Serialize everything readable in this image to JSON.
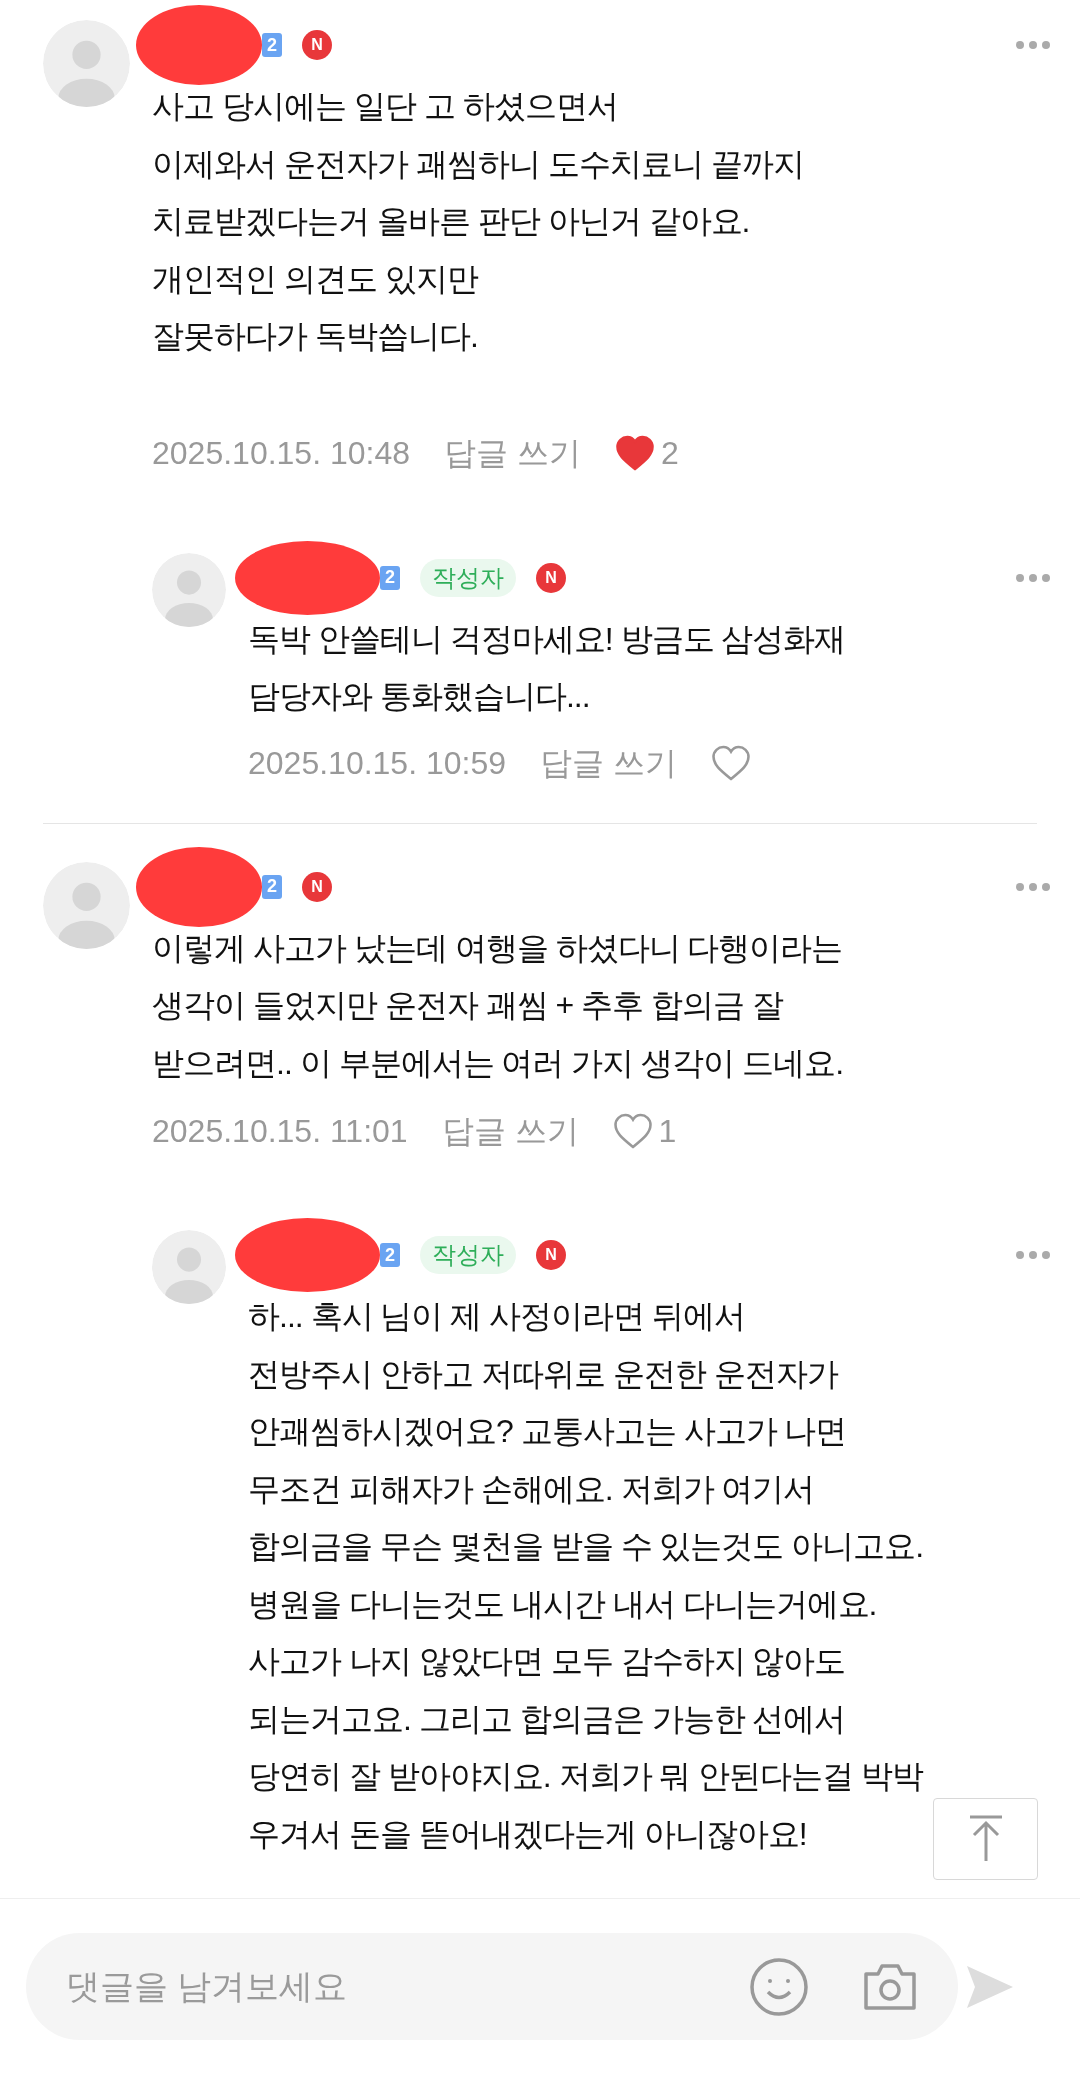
{
  "comments": [
    {
      "kind": "comment",
      "level_badge": "2",
      "new_badge": "N",
      "body": [
        "사고 당시에는 일단 고 하셨으면서",
        "이제와서 운전자가 괘씸하니 도수치료니 끝까지",
        "치료받겠다는거 올바른 판단 아닌거 같아요.",
        "개인적인 의견도 있지만",
        "잘못하다가 독박씁니다."
      ],
      "date": "2025.10.15. 10:48",
      "reply_label": "답글 쓰기",
      "liked": true,
      "like_count": "2"
    },
    {
      "kind": "reply",
      "level_badge": "2",
      "author_tag": "작성자",
      "new_badge": "N",
      "body": [
        "독박 안쓸테니 걱정마세요! 방금도 삼성화재",
        "담당자와 통화했습니다..."
      ],
      "date": "2025.10.15. 10:59",
      "reply_label": "답글 쓰기",
      "liked": false
    },
    {
      "kind": "comment",
      "level_badge": "2",
      "new_badge": "N",
      "body": [
        "이렇게 사고가 났는데 여행을 하셨다니 다행이라는",
        "생각이 들었지만 운전자 괘씸 + 추후 합의금 잘",
        "받으려면.. 이 부분에서는 여러 가지 생각이 드네요."
      ],
      "date": "2025.10.15. 11:01",
      "reply_label": "답글 쓰기",
      "liked": false,
      "like_count": "1"
    },
    {
      "kind": "reply",
      "level_badge": "2",
      "author_tag": "작성자",
      "new_badge": "N",
      "body": [
        "하... 혹시 님이 제 사정이라면 뒤에서",
        "전방주시 안하고 저따위로 운전한 운전자가",
        "안괘씸하시겠어요? 교통사고는 사고가 나면",
        "무조건 피해자가 손해에요. 저희가 여기서",
        "합의금을 무슨 몇천을 받을 수 있는것도 아니고요.",
        "병원을 다니는것도 내시간 내서 다니는거에요.",
        "사고가 나지 않았다면 모두 감수하지 않아도",
        "되는거고요. 그리고 합의금은 가능한 선에서",
        "당연히 잘 받아야지요. 저희가 뭐 안된다는걸 박박",
        "우겨서 돈을 뜯어내겠다는게 아니잖아요!"
      ]
    }
  ],
  "comment_input": {
    "placeholder": "댓글을 남겨보세요"
  }
}
